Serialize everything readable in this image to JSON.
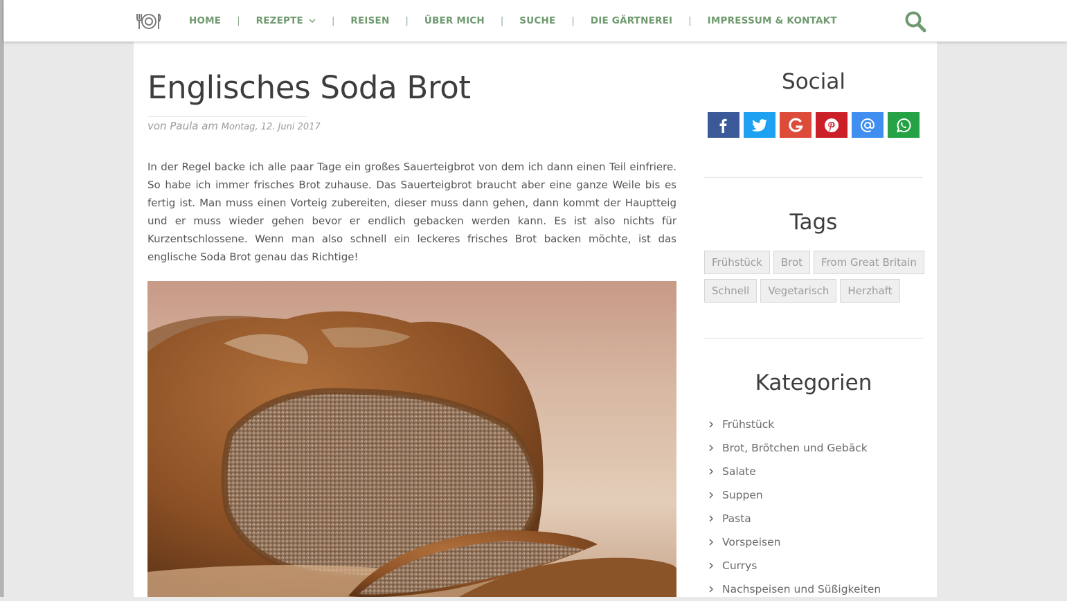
{
  "nav": {
    "items": [
      {
        "label": "HOME"
      },
      {
        "label": "REZEPTE"
      },
      {
        "label": "REISEN"
      },
      {
        "label": "ÜBER MICH"
      },
      {
        "label": "SUCHE"
      },
      {
        "label": "DIE GÄRTNEREI"
      },
      {
        "label": "IMPRESSUM & KONTAKT"
      }
    ],
    "separator": "|",
    "dropdown_icon": "chevron-down-icon",
    "search_icon": "search-icon",
    "accent_color": "#6f9a6f"
  },
  "post": {
    "title": "Englisches Soda Brot",
    "meta_prefix": "von Paula am",
    "date": "Montag, 12. Juni 2017",
    "intro": "In der Regel backe ich alle paar Tage ein großes Sauerteigbrot von dem ich dann einen Teil einfriere. So habe ich immer frisches Brot zuhause. Das Sauerteigbrot braucht aber eine ganze Weile bis es fertig ist. Man muss einen Vorteig zubereiten, dieser muss dann gehen, dann kommt der Hauptteig und er muss wieder gehen bevor er endlich gebacken werden kann. Es ist also nichts für Kurzentschlossene. Wenn man also schnell ein leckeres frisches Brot backen möchte, ist das englische Soda Brot genau das Richtige!"
  },
  "sidebar": {
    "social_title": "Social",
    "social": [
      {
        "icon": "facebook-icon",
        "color": "#3b5998"
      },
      {
        "icon": "twitter-icon",
        "color": "#1da1f2"
      },
      {
        "icon": "google-icon",
        "color": "#dd4b39"
      },
      {
        "icon": "pinterest-icon",
        "color": "#cb2027"
      },
      {
        "icon": "email-icon",
        "color": "#3f8ef0"
      },
      {
        "icon": "whatsapp-icon",
        "color": "#25a244"
      }
    ],
    "tags_title": "Tags",
    "tags": [
      "Frühstück",
      "Brot",
      "From Great Britain",
      "Schnell",
      "Vegetarisch",
      "Herzhaft"
    ],
    "categories_title": "Kategorien",
    "categories": [
      "Frühstück",
      "Brot, Brötchen und Gebäck",
      "Salate",
      "Suppen",
      "Pasta",
      "Vorspeisen",
      "Currys",
      "Nachspeisen und Süßigkeiten"
    ]
  }
}
